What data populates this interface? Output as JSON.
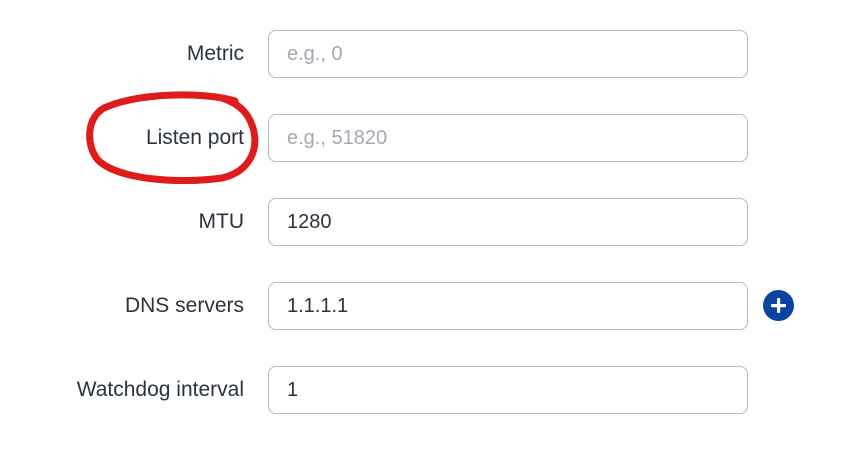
{
  "form": {
    "rows": [
      {
        "label": "Metric",
        "value": "",
        "placeholder": "e.g., 0"
      },
      {
        "label": "Listen port",
        "value": "",
        "placeholder": "e.g., 51820"
      },
      {
        "label": "MTU",
        "value": "1280",
        "placeholder": ""
      },
      {
        "label": "DNS servers",
        "value": "1.1.1.1",
        "placeholder": ""
      },
      {
        "label": "Watchdog interval",
        "value": "1",
        "placeholder": ""
      }
    ],
    "add_dns_icon": "plus-circle-icon"
  },
  "annotation": {
    "color": "#e01b1b",
    "shape": "hand-drawn-ellipse",
    "target": "Listen port"
  },
  "colors": {
    "accent": "#0a44a0",
    "border": "#b3b8bf",
    "label": "#2b333e",
    "placeholder": "#a4aab2"
  }
}
